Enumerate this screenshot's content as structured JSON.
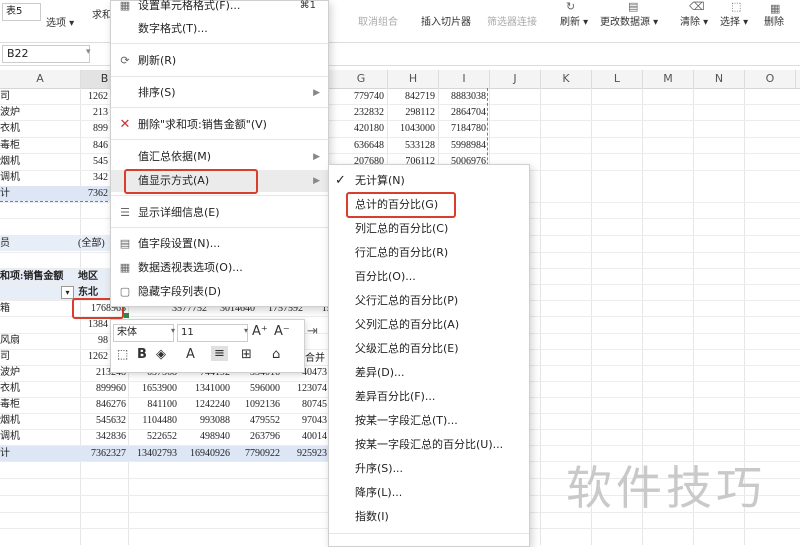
{
  "ribbon": {
    "style_box": "表5",
    "options_label": "选项",
    "field_label": "求和",
    "cancel_group": "取消组合",
    "insert_slicer": "插入切片器",
    "filter_connect": "筛选器连接",
    "refresh": "刷新",
    "change_source": "更改数据源",
    "clear": "清除",
    "select": "选择",
    "delete": "删除"
  },
  "name_box": "B22",
  "columns": [
    "A",
    "B",
    "",
    "",
    "",
    "",
    "G",
    "H",
    "I",
    "J",
    "K",
    "L",
    "M",
    "N",
    "O"
  ],
  "grid_top": {
    "rows": [
      {
        "a": "司",
        "b": "1262",
        "g": "779740",
        "h": "842719",
        "i": "8883038"
      },
      {
        "a": "波炉",
        "b": "213",
        "g": "232832",
        "h": "298112",
        "i": "2864704"
      },
      {
        "a": "衣机",
        "b": "899",
        "g": "420180",
        "h": "1043000",
        "i": "7184780"
      },
      {
        "a": "毒柜",
        "b": "846",
        "g": "636648",
        "h": "533128",
        "i": "5998984"
      },
      {
        "a": "烟机",
        "b": "545",
        "g": "207680",
        "h": "706112",
        "i": "5006976"
      },
      {
        "a": "调机",
        "b": "342",
        "g": "",
        "h": "",
        "i": ""
      },
      {
        "a": "计",
        "b": "7362",
        "g": "",
        "h": "",
        "i": ""
      }
    ]
  },
  "grid_bottom": {
    "filter_label": "员",
    "filter_value": "(全部)",
    "sum_field": "和项:销售金额",
    "region_label": "地区",
    "region_value": "东北",
    "rows": [
      {
        "a": "箱",
        "vals": [
          "1768963",
          "3577752",
          "3014640",
          "1757592",
          "191116"
        ]
      },
      {
        "a": "",
        "vals": [
          "1384",
          "",
          "",
          "",
          ""
        ]
      },
      {
        "a": "风扇",
        "vals": [
          "98",
          "",
          "",
          "",
          ""
        ]
      },
      {
        "a": "司",
        "vals": [
          "1262",
          "",
          "",
          "",
          ""
        ]
      },
      {
        "a": "波炉",
        "vals": [
          "213248",
          "637568",
          "744192",
          "334016",
          "40473"
        ]
      },
      {
        "a": "衣机",
        "vals": [
          "899960",
          "1653900",
          "1341000",
          "596000",
          "123074"
        ]
      },
      {
        "a": "毒柜",
        "vals": [
          "846276",
          "841100",
          "1242240",
          "1092136",
          "80745"
        ]
      },
      {
        "a": "烟机",
        "vals": [
          "545632",
          "1104480",
          "993088",
          "479552",
          "97043"
        ]
      },
      {
        "a": "调机",
        "vals": [
          "342836",
          "522652",
          "498940",
          "263796",
          "40014"
        ]
      },
      {
        "a": "计",
        "vals": [
          "7362327",
          "13402793",
          "16940926",
          "7790922",
          "925923"
        ]
      }
    ]
  },
  "context_menu": {
    "items": [
      {
        "label": "设置单元格格式(F)...",
        "shortcut": "⌘1"
      },
      {
        "label": "数字格式(T)..."
      },
      {
        "label": "刷新(R)"
      },
      {
        "label": "排序(S)"
      },
      {
        "label": "删除\"求和项:销售金额\"(V)"
      },
      {
        "label": "值汇总依据(M)"
      },
      {
        "label": "值显示方式(A)"
      },
      {
        "label": "显示详细信息(E)"
      },
      {
        "label": "值字段设置(N)..."
      },
      {
        "label": "数据透视表选项(O)..."
      },
      {
        "label": "隐藏字段列表(D)"
      }
    ]
  },
  "mini_toolbar": {
    "font_name": "宋体",
    "font_size": "11",
    "merge_label": "合并"
  },
  "submenu": {
    "items": [
      "无计算(N)",
      "总计的百分比(G)",
      "列汇总的百分比(C)",
      "行汇总的百分比(R)",
      "百分比(O)...",
      "父行汇总的百分比(P)",
      "父列汇总的百分比(A)",
      "父级汇总的百分比(E)",
      "差异(D)...",
      "差异百分比(F)...",
      "按某一字段汇总(T)...",
      "按某一字段汇总的百分比(U)...",
      "升序(S)...",
      "降序(L)...",
      "指数(I)"
    ]
  },
  "watermark": "软件技巧",
  "colors": {
    "highlight_red": "#d93d2b",
    "total_row": "#dde6f5",
    "menu_hover": "#ebebeb"
  }
}
